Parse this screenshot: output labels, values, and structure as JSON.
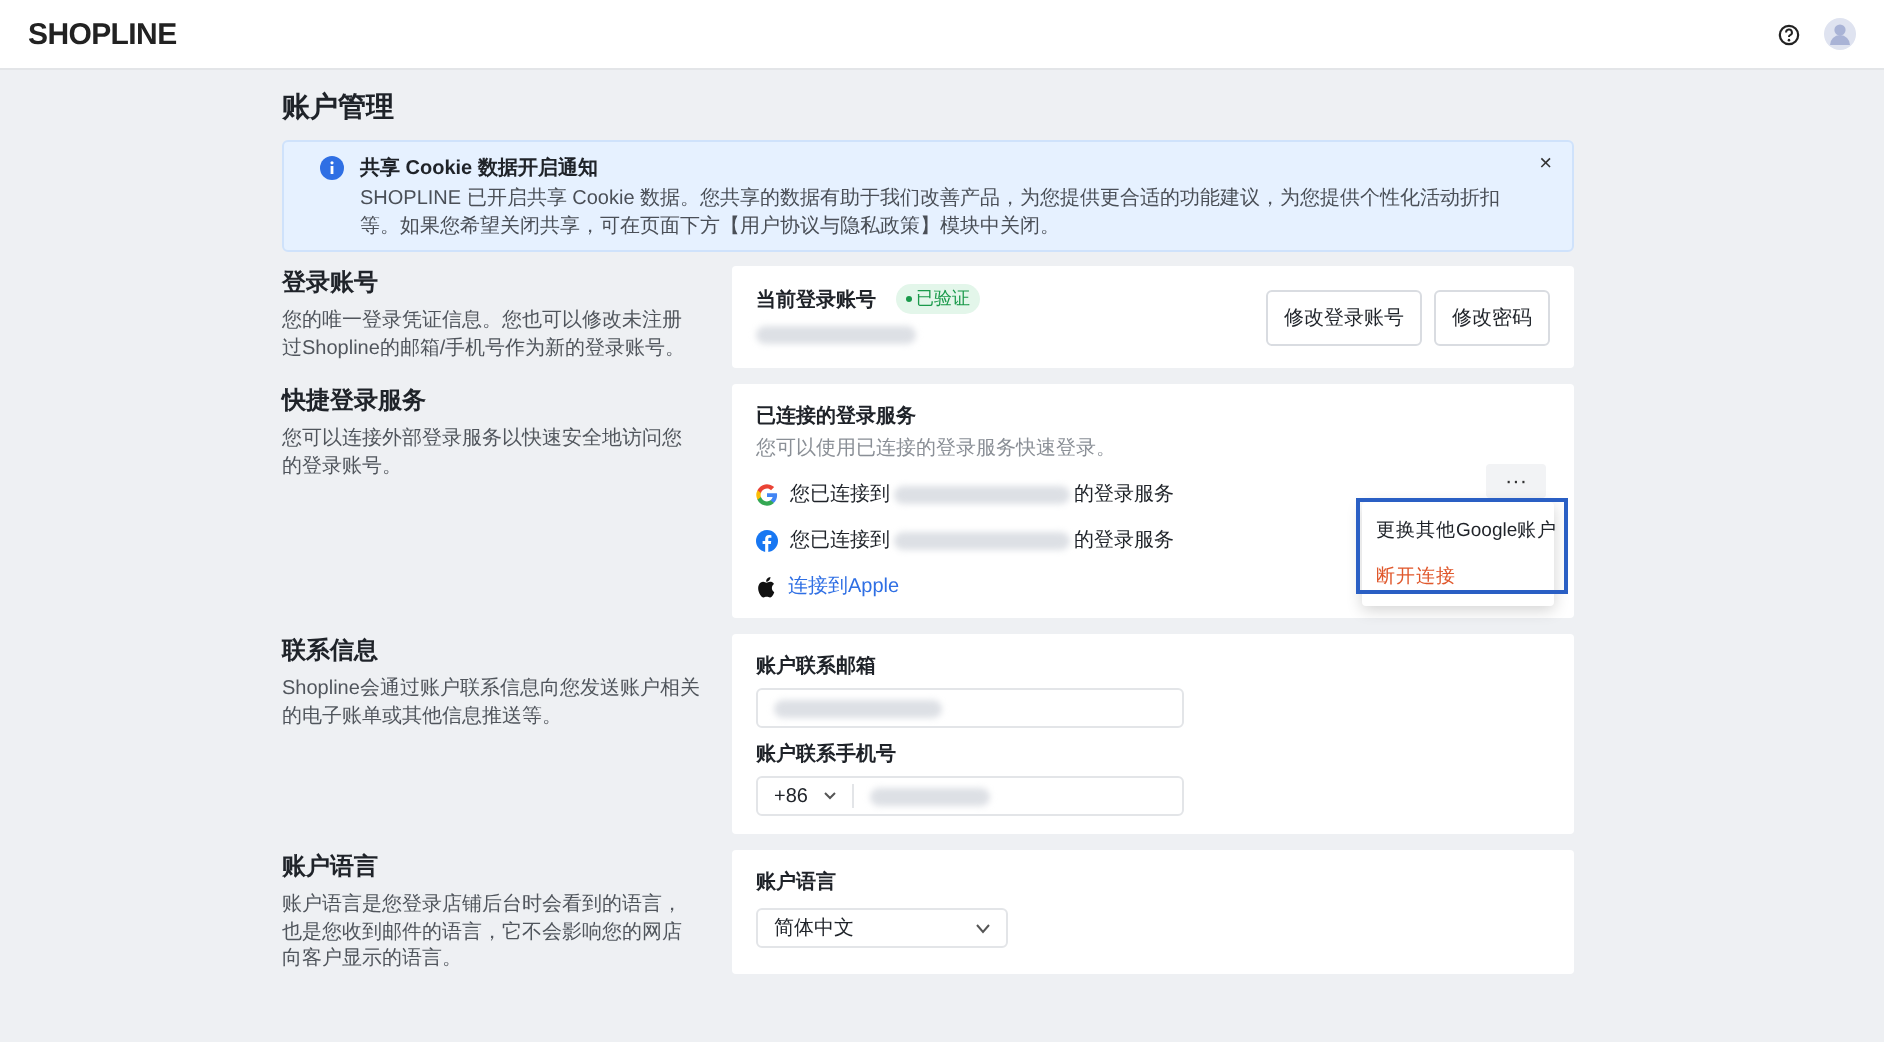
{
  "header": {
    "logo": "SHOPLINE"
  },
  "page_title": "账户管理",
  "notice": {
    "title": "共享 Cookie 数据开启通知",
    "body": "SHOPLINE 已开启共享 Cookie 数据。您共享的数据有助于我们改善产品，为您提供更合适的功能建议，为您提供个性化活动折扣等。如果您希望关闭共享，可在页面下方【用户协议与隐私政策】模块中关闭。",
    "close": "×"
  },
  "sections": [
    {
      "kind": "login",
      "title": "登录账号",
      "description": "您的唯一登录凭证信息。您也可以修改未注册过Shopline的邮箱/手机号作为新的登录账号。",
      "label": "当前登录账号",
      "badge": "已验证",
      "buttons": [
        "修改登录账号",
        "修改密码"
      ]
    },
    {
      "kind": "quick",
      "title": "快捷登录服务",
      "description": "您可以连接外部登录服务以快速安全地访问您的登录账号。",
      "heading": "已连接的登录服务",
      "subheading": "您可以使用已连接的登录服务快速登录。",
      "more": "···",
      "services": [
        {
          "kind": "google",
          "connected": true,
          "prefix": "您已连接到",
          "suffix": "的登录服务"
        },
        {
          "kind": "facebook",
          "connected": true,
          "prefix": "您已连接到",
          "suffix": "的登录服务"
        },
        {
          "kind": "apple",
          "connected": false,
          "link": "连接到Apple"
        }
      ],
      "menu": [
        {
          "label": "更换其他Google账户",
          "kind": "normal"
        },
        {
          "label": "断开连接",
          "kind": "danger"
        }
      ]
    },
    {
      "kind": "contact",
      "title": "联系信息",
      "description": "Shopline会通过账户联系信息向您发送账户相关的电子账单或其他信息推送等。",
      "email_label": "账户联系邮箱",
      "phone_label": "账户联系手机号",
      "country_code": "+86"
    },
    {
      "kind": "language",
      "title": "账户语言",
      "description": "账户语言是您登录店铺后台时会看到的语言，也是您收到邮件的语言，它不会影响您的网店向客户显示的语言。",
      "field_label": "账户语言",
      "value": "简体中文"
    }
  ]
}
